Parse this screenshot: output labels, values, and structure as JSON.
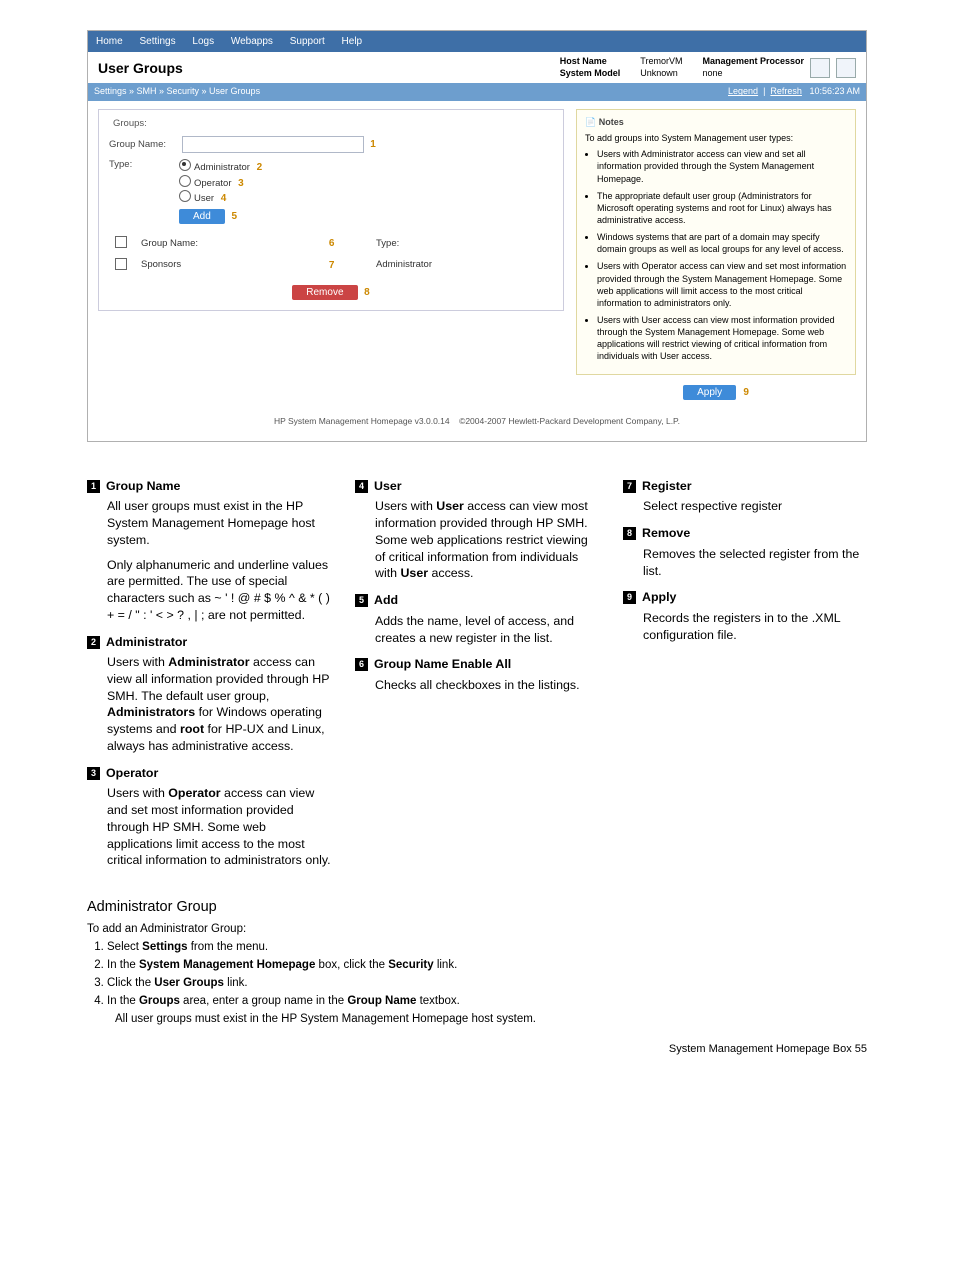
{
  "menubar": [
    "Home",
    "Settings",
    "Logs",
    "Webapps",
    "Support",
    "Help"
  ],
  "title": "User Groups",
  "meta": {
    "hn_l": "Host Name",
    "hn_v": "TremorVM",
    "sm_l": "System Model",
    "sm_v": "Unknown",
    "mp_l": "Management Processor",
    "mp_v": "none"
  },
  "toolbar": {
    "crumbs": "Settings » SMH » Security » User Groups",
    "legend": "Legend",
    "refresh": "Refresh",
    "time": "10:56:23 AM"
  },
  "groups": {
    "legend": "Groups:",
    "gn_l": "Group Name:",
    "type_l": "Type:",
    "r1": "Administrator",
    "r2": "Operator",
    "r3": "User",
    "add": "Add",
    "remove": "Remove",
    "col1": "Group Name:",
    "col2": "Type:",
    "row1_name": "Sponsors",
    "row1_type": "Administrator",
    "c": {
      "1": "1",
      "2": "2",
      "3": "3",
      "4": "4",
      "5": "5",
      "6": "6",
      "7": "7",
      "8": "8",
      "9": "9"
    }
  },
  "notes": {
    "h": "Notes",
    "intro": "To add groups into System Management user types:",
    "b1": "Users with Administrator access can view and set all information provided through the System Management Homepage.",
    "b2": "The appropriate default user group (Administrators for Microsoft operating systems and root for Linux) always has administrative access.",
    "b3": "Windows systems that are part of a domain may specify domain groups as well as local groups for any level of access.",
    "b4": "Users with Operator access can view and set most information provided through the System Management Homepage. Some web applications will limit access to the most critical information to administrators only.",
    "b5": "Users with User access can view most information provided through the System Management Homepage. Some web applications will restrict viewing of critical information from individuals with User access."
  },
  "apply": "Apply",
  "foot": {
    "l": "HP System Management Homepage v3.0.0.14",
    "r": "©2004-2007 Hewlett-Packard Development Company, L.P."
  },
  "defs": {
    "n1": "1",
    "t1": "Group Name",
    "d1a": "All user groups must exist in the HP System Management Homepage host system.",
    "d1b": "Only alphanumeric and underline values are permitted. The use of special characters such as ~ ' ! @ # $ % ^ & * ( ) + = / \" : ' < > ? , | ; are not permitted.",
    "n2": "2",
    "t2": "Administrator",
    "d2a": "Users with ",
    "d2b": "Administrator",
    "d2c": " access can view all information provided through HP SMH. The default user group, ",
    "d2d": "Administrators",
    "d2e": " for Windows operating systems and ",
    "d2f": "root",
    "d2g": " for HP-UX and Linux, always has administrative access.",
    "n3": "3",
    "t3": "Operator",
    "d3a": "Users with ",
    "d3b": "Operator",
    "d3c": " access can view and set most information provided through HP SMH. Some web applications limit access to the most critical information to administrators only.",
    "n4": "4",
    "t4": "User",
    "d4a": "Users with ",
    "d4b": "User",
    "d4c": " access can view most information provided through HP SMH. Some web applications restrict viewing of critical information from individuals with ",
    "d4d": "User",
    "d4e": " access.",
    "n5": "5",
    "t5": "Add",
    "d5": "Adds the name, level of access, and creates a new register in the list.",
    "n6": "6",
    "t6": "Group Name Enable All",
    "d6": "Checks all checkboxes in the listings.",
    "n7": "7",
    "t7": "Register",
    "d7": "Select respective register",
    "n8": "8",
    "t8": "Remove",
    "d8": "Removes the selected register from the list.",
    "n9": "9",
    "t9": "Apply",
    "d9": "Records the registers in to the .XML configuration file."
  },
  "admgroup": {
    "h": "Administrator Group",
    "intro": "To add an Administrator Group:",
    "s1a": "Select ",
    "s1b": "Settings",
    "s1c": " from the menu.",
    "s2a": "In the ",
    "s2b": "System Management Homepage",
    "s2c": " box, click the ",
    "s2d": "Security",
    "s2e": " link.",
    "s3a": "Click the ",
    "s3b": "User Groups",
    "s3c": " link.",
    "s4a": "In the ",
    "s4b": "Groups",
    "s4c": " area, enter a group name in the ",
    "s4d": "Group Name",
    "s4e": " textbox.",
    "s4n": "All user groups must exist in the HP System Management Homepage host system."
  },
  "pagefoot": "System Management Homepage Box    55"
}
